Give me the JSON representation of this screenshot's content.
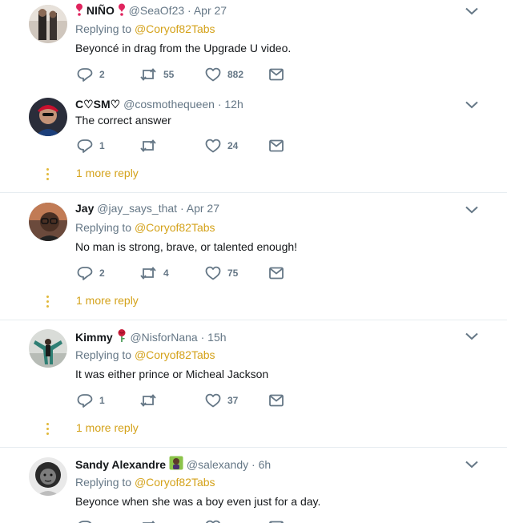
{
  "tweets": [
    {
      "name": "NIÑO",
      "handle": "@SeaOf23",
      "time": "· Apr 27",
      "replying_label": "Replying to",
      "replying_to": "@Coryof82Tabs",
      "text": "Beyoncé in drag from the Upgrade U video.",
      "replies": "2",
      "retweets": "55",
      "likes": "882"
    },
    {
      "name": "C♡SM♡",
      "handle": "@cosmothequeen",
      "time": "· 12h",
      "text": "The correct answer",
      "replies": "1",
      "retweets": "",
      "likes": "24",
      "more_replies": "1 more reply"
    },
    {
      "name": "Jay",
      "handle": "@jay_says_that",
      "time": "· Apr 27",
      "replying_label": "Replying to",
      "replying_to": "@Coryof82Tabs",
      "text": "No man is strong, brave, or talented enough!",
      "replies": "2",
      "retweets": "4",
      "likes": "75",
      "more_replies": "1 more reply"
    },
    {
      "name": "Kimmy",
      "handle": "@NisforNana",
      "time": "· 15h",
      "replying_label": "Replying to",
      "replying_to": "@Coryof82Tabs",
      "text": "It was either prince or Micheal Jackson",
      "replies": "1",
      "retweets": "",
      "likes": "37",
      "more_replies": "1 more reply"
    },
    {
      "name": "Sandy Alexandre",
      "handle": "@salexandy",
      "time": "· 6h",
      "replying_label": "Replying to",
      "replying_to": "@Coryof82Tabs",
      "text": "Beyonce when she was a boy even just for a day."
    }
  ],
  "colors": {
    "mention": "#d4a21a",
    "muted": "#657786",
    "divider": "#e6ecf0"
  },
  "icons": [
    "reply-icon",
    "retweet-icon",
    "like-icon",
    "direct-message-icon",
    "chevron-down-icon",
    "heart-exclamation-icon",
    "rose-icon",
    "user-emoji-icon"
  ]
}
